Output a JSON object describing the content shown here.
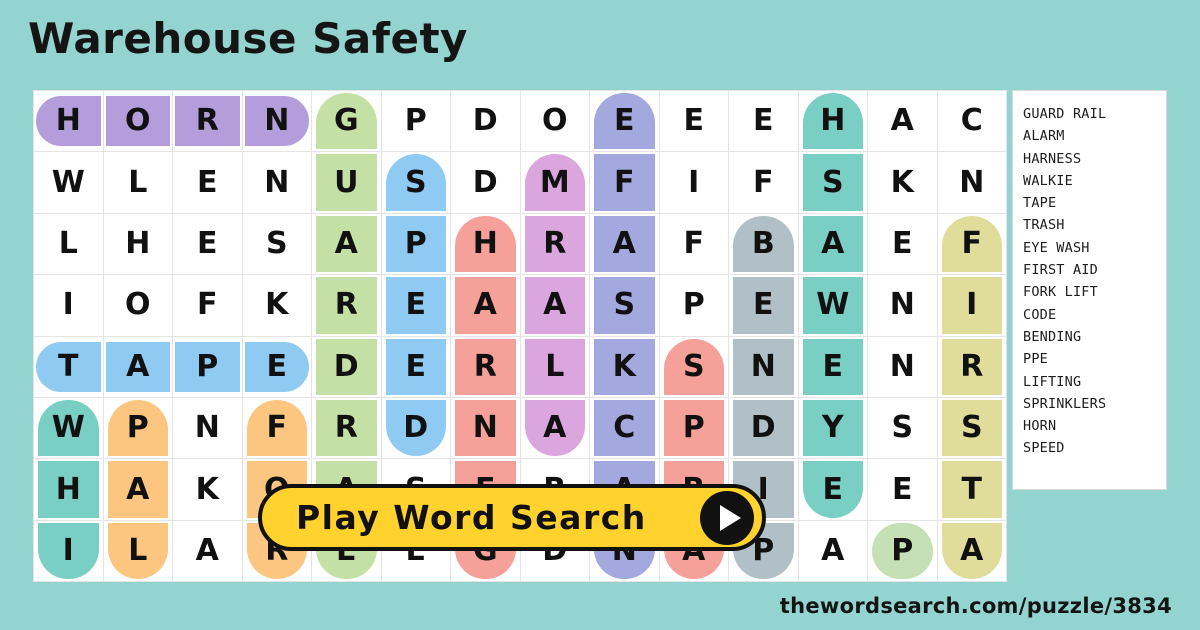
{
  "title": "Warehouse Safety",
  "footer": {
    "url": "thewordsearch.com/puzzle/3834"
  },
  "play_button": {
    "label": "Play Word Search",
    "icon": "play-triangle-icon"
  },
  "colors": {
    "background": "#93d4d0",
    "grid_background": "#ffffff",
    "grid_line": "#e4e4e4",
    "button": "#ffd22e",
    "button_border": "#111111",
    "text": "#111111",
    "purple": "#b39ddb",
    "green": "#c5e0a5",
    "blue": "#8ecaf2",
    "orchid": "#dba6dd",
    "salmon": "#f6a09a",
    "periwinkle": "#a3a9de",
    "slate": "#b0c0c6",
    "teal": "#79cfc4",
    "khaki": "#e0dc9a",
    "orange": "#fcc680",
    "mint": "#c5e0b4"
  },
  "word_list": {
    "words": [
      "GUARD RAIL",
      "ALARM",
      "HARNESS",
      "WALKIE",
      "TAPE",
      "TRASH",
      "EYE WASH",
      "FIRST AID",
      "FORK LIFT",
      "CODE",
      "BENDING",
      "PPE",
      "LIFTING",
      "SPRINKLERS",
      "HORN",
      "SPEED"
    ]
  },
  "grid": {
    "columns": 14,
    "rows": 8,
    "letters": [
      [
        "H",
        "O",
        "R",
        "N",
        "G",
        "P",
        "D",
        "O",
        "E",
        "E",
        "E",
        "H",
        "A",
        "C"
      ],
      [
        "W",
        "L",
        "E",
        "N",
        "U",
        "S",
        "D",
        "M",
        "F",
        "I",
        "F",
        "S",
        "K",
        "N"
      ],
      [
        "L",
        "H",
        "E",
        "S",
        "A",
        "P",
        "H",
        "R",
        "A",
        "F",
        "B",
        "A",
        "E",
        "F"
      ],
      [
        "I",
        "O",
        "F",
        "K",
        "R",
        "E",
        "A",
        "A",
        "S",
        "P",
        "E",
        "W",
        "N",
        "I"
      ],
      [
        "T",
        "A",
        "P",
        "E",
        "D",
        "E",
        "R",
        "L",
        "K",
        "S",
        "N",
        "E",
        "N",
        "R"
      ],
      [
        "W",
        "P",
        "N",
        "F",
        "R",
        "D",
        "N",
        "A",
        "C",
        "P",
        "D",
        "Y",
        "S",
        "S"
      ],
      [
        "H",
        "A",
        "K",
        "O",
        "A",
        "S",
        "E",
        "R",
        "A",
        "R",
        "I",
        "E",
        "E",
        "T"
      ],
      [
        "I",
        "L",
        "A",
        "R",
        "E",
        "E",
        "G",
        "D",
        "N",
        "A",
        "P",
        "A",
        "P",
        "A"
      ]
    ],
    "highlights": [
      {
        "r": 0,
        "c": 0,
        "color": "#b39ddb",
        "shape": "cap-l",
        "orient": "h"
      },
      {
        "r": 0,
        "c": 1,
        "color": "#b39ddb",
        "shape": "",
        "orient": "h"
      },
      {
        "r": 0,
        "c": 2,
        "color": "#b39ddb",
        "shape": "",
        "orient": "h"
      },
      {
        "r": 0,
        "c": 3,
        "color": "#b39ddb",
        "shape": "cap-r",
        "orient": "h"
      },
      {
        "r": 0,
        "c": 4,
        "color": "#c5e0a5",
        "shape": "cap-t",
        "orient": "v"
      },
      {
        "r": 1,
        "c": 4,
        "color": "#c5e0a5",
        "shape": "",
        "orient": "v"
      },
      {
        "r": 2,
        "c": 4,
        "color": "#c5e0a5",
        "shape": "",
        "orient": "v"
      },
      {
        "r": 3,
        "c": 4,
        "color": "#c5e0a5",
        "shape": "",
        "orient": "v"
      },
      {
        "r": 4,
        "c": 4,
        "color": "#c5e0a5",
        "shape": "",
        "orient": "v"
      },
      {
        "r": 5,
        "c": 4,
        "color": "#c5e0a5",
        "shape": "",
        "orient": "v"
      },
      {
        "r": 6,
        "c": 4,
        "color": "#c5e0a5",
        "shape": "",
        "orient": "v"
      },
      {
        "r": 7,
        "c": 4,
        "color": "#c5e0a5",
        "shape": "cap-b",
        "orient": "v"
      },
      {
        "r": 1,
        "c": 5,
        "color": "#8ecaf2",
        "shape": "cap-t",
        "orient": "v"
      },
      {
        "r": 2,
        "c": 5,
        "color": "#8ecaf2",
        "shape": "",
        "orient": "v"
      },
      {
        "r": 3,
        "c": 5,
        "color": "#8ecaf2",
        "shape": "",
        "orient": "v"
      },
      {
        "r": 4,
        "c": 5,
        "color": "#8ecaf2",
        "shape": "",
        "orient": "v"
      },
      {
        "r": 5,
        "c": 5,
        "color": "#8ecaf2",
        "shape": "cap-b",
        "orient": "v"
      },
      {
        "r": 2,
        "c": 6,
        "color": "#f6a09a",
        "shape": "cap-t",
        "orient": "v"
      },
      {
        "r": 3,
        "c": 6,
        "color": "#f6a09a",
        "shape": "",
        "orient": "v"
      },
      {
        "r": 4,
        "c": 6,
        "color": "#f6a09a",
        "shape": "",
        "orient": "v"
      },
      {
        "r": 5,
        "c": 6,
        "color": "#f6a09a",
        "shape": "",
        "orient": "v"
      },
      {
        "r": 6,
        "c": 6,
        "color": "#f6a09a",
        "shape": "",
        "orient": "v"
      },
      {
        "r": 7,
        "c": 6,
        "color": "#f6a09a",
        "shape": "cap-b",
        "orient": "v"
      },
      {
        "r": 1,
        "c": 7,
        "color": "#dba6dd",
        "shape": "cap-t",
        "orient": "v"
      },
      {
        "r": 2,
        "c": 7,
        "color": "#dba6dd",
        "shape": "",
        "orient": "v"
      },
      {
        "r": 3,
        "c": 7,
        "color": "#dba6dd",
        "shape": "",
        "orient": "v"
      },
      {
        "r": 4,
        "c": 7,
        "color": "#dba6dd",
        "shape": "",
        "orient": "v"
      },
      {
        "r": 5,
        "c": 7,
        "color": "#dba6dd",
        "shape": "cap-b",
        "orient": "v"
      },
      {
        "r": 0,
        "c": 8,
        "color": "#a3a9de",
        "shape": "cap-t",
        "orient": "v"
      },
      {
        "r": 1,
        "c": 8,
        "color": "#a3a9de",
        "shape": "",
        "orient": "v"
      },
      {
        "r": 2,
        "c": 8,
        "color": "#a3a9de",
        "shape": "",
        "orient": "v"
      },
      {
        "r": 3,
        "c": 8,
        "color": "#a3a9de",
        "shape": "",
        "orient": "v"
      },
      {
        "r": 4,
        "c": 8,
        "color": "#a3a9de",
        "shape": "",
        "orient": "v"
      },
      {
        "r": 5,
        "c": 8,
        "color": "#a3a9de",
        "shape": "",
        "orient": "v"
      },
      {
        "r": 6,
        "c": 8,
        "color": "#a3a9de",
        "shape": "",
        "orient": "v"
      },
      {
        "r": 7,
        "c": 8,
        "color": "#a3a9de",
        "shape": "cap-b",
        "orient": "v"
      },
      {
        "r": 4,
        "c": 9,
        "color": "#f6a09a",
        "shape": "cap-t",
        "orient": "v"
      },
      {
        "r": 5,
        "c": 9,
        "color": "#f6a09a",
        "shape": "",
        "orient": "v"
      },
      {
        "r": 6,
        "c": 9,
        "color": "#f6a09a",
        "shape": "",
        "orient": "v"
      },
      {
        "r": 7,
        "c": 9,
        "color": "#f6a09a",
        "shape": "cap-b",
        "orient": "v"
      },
      {
        "r": 2,
        "c": 10,
        "color": "#b0c0c6",
        "shape": "cap-t",
        "orient": "v"
      },
      {
        "r": 3,
        "c": 10,
        "color": "#b0c0c6",
        "shape": "",
        "orient": "v"
      },
      {
        "r": 4,
        "c": 10,
        "color": "#b0c0c6",
        "shape": "",
        "orient": "v"
      },
      {
        "r": 5,
        "c": 10,
        "color": "#b0c0c6",
        "shape": "",
        "orient": "v"
      },
      {
        "r": 6,
        "c": 10,
        "color": "#b0c0c6",
        "shape": "",
        "orient": "v"
      },
      {
        "r": 7,
        "c": 10,
        "color": "#b0c0c6",
        "shape": "cap-b",
        "orient": "v"
      },
      {
        "r": 0,
        "c": 11,
        "color": "#79cfc4",
        "shape": "cap-t",
        "orient": "v"
      },
      {
        "r": 1,
        "c": 11,
        "color": "#79cfc4",
        "shape": "",
        "orient": "v"
      },
      {
        "r": 2,
        "c": 11,
        "color": "#79cfc4",
        "shape": "",
        "orient": "v"
      },
      {
        "r": 3,
        "c": 11,
        "color": "#79cfc4",
        "shape": "",
        "orient": "v"
      },
      {
        "r": 4,
        "c": 11,
        "color": "#79cfc4",
        "shape": "",
        "orient": "v"
      },
      {
        "r": 5,
        "c": 11,
        "color": "#79cfc4",
        "shape": "",
        "orient": "v"
      },
      {
        "r": 6,
        "c": 11,
        "color": "#79cfc4",
        "shape": "cap-b",
        "orient": "v"
      },
      {
        "r": 2,
        "c": 13,
        "color": "#e0dc9a",
        "shape": "cap-t",
        "orient": "v"
      },
      {
        "r": 3,
        "c": 13,
        "color": "#e0dc9a",
        "shape": "",
        "orient": "v"
      },
      {
        "r": 4,
        "c": 13,
        "color": "#e0dc9a",
        "shape": "",
        "orient": "v"
      },
      {
        "r": 5,
        "c": 13,
        "color": "#e0dc9a",
        "shape": "",
        "orient": "v"
      },
      {
        "r": 6,
        "c": 13,
        "color": "#e0dc9a",
        "shape": "",
        "orient": "v"
      },
      {
        "r": 7,
        "c": 13,
        "color": "#e0dc9a",
        "shape": "cap-b",
        "orient": "v"
      },
      {
        "r": 4,
        "c": 0,
        "color": "#8ecaf2",
        "shape": "cap-l",
        "orient": "h"
      },
      {
        "r": 4,
        "c": 1,
        "color": "#8ecaf2",
        "shape": "",
        "orient": "h"
      },
      {
        "r": 4,
        "c": 2,
        "color": "#8ecaf2",
        "shape": "",
        "orient": "h"
      },
      {
        "r": 4,
        "c": 3,
        "color": "#8ecaf2",
        "shape": "cap-r",
        "orient": "h"
      },
      {
        "r": 5,
        "c": 0,
        "color": "#79cfc4",
        "shape": "cap-t",
        "orient": "v"
      },
      {
        "r": 6,
        "c": 0,
        "color": "#79cfc4",
        "shape": "",
        "orient": "v"
      },
      {
        "r": 7,
        "c": 0,
        "color": "#79cfc4",
        "shape": "cap-b",
        "orient": "v"
      },
      {
        "r": 5,
        "c": 1,
        "color": "#fcc680",
        "shape": "cap-t",
        "orient": "v"
      },
      {
        "r": 6,
        "c": 1,
        "color": "#fcc680",
        "shape": "",
        "orient": "v"
      },
      {
        "r": 7,
        "c": 1,
        "color": "#fcc680",
        "shape": "cap-b",
        "orient": "v"
      },
      {
        "r": 5,
        "c": 3,
        "color": "#fcc680",
        "shape": "cap-t",
        "orient": "v"
      },
      {
        "r": 6,
        "c": 3,
        "color": "#fcc680",
        "shape": "",
        "orient": "v"
      },
      {
        "r": 7,
        "c": 3,
        "color": "#fcc680",
        "shape": "cap-b",
        "orient": "v"
      },
      {
        "r": 7,
        "c": 12,
        "color": "#c5e0b4",
        "shape": "cap-all",
        "orient": "v"
      }
    ]
  }
}
